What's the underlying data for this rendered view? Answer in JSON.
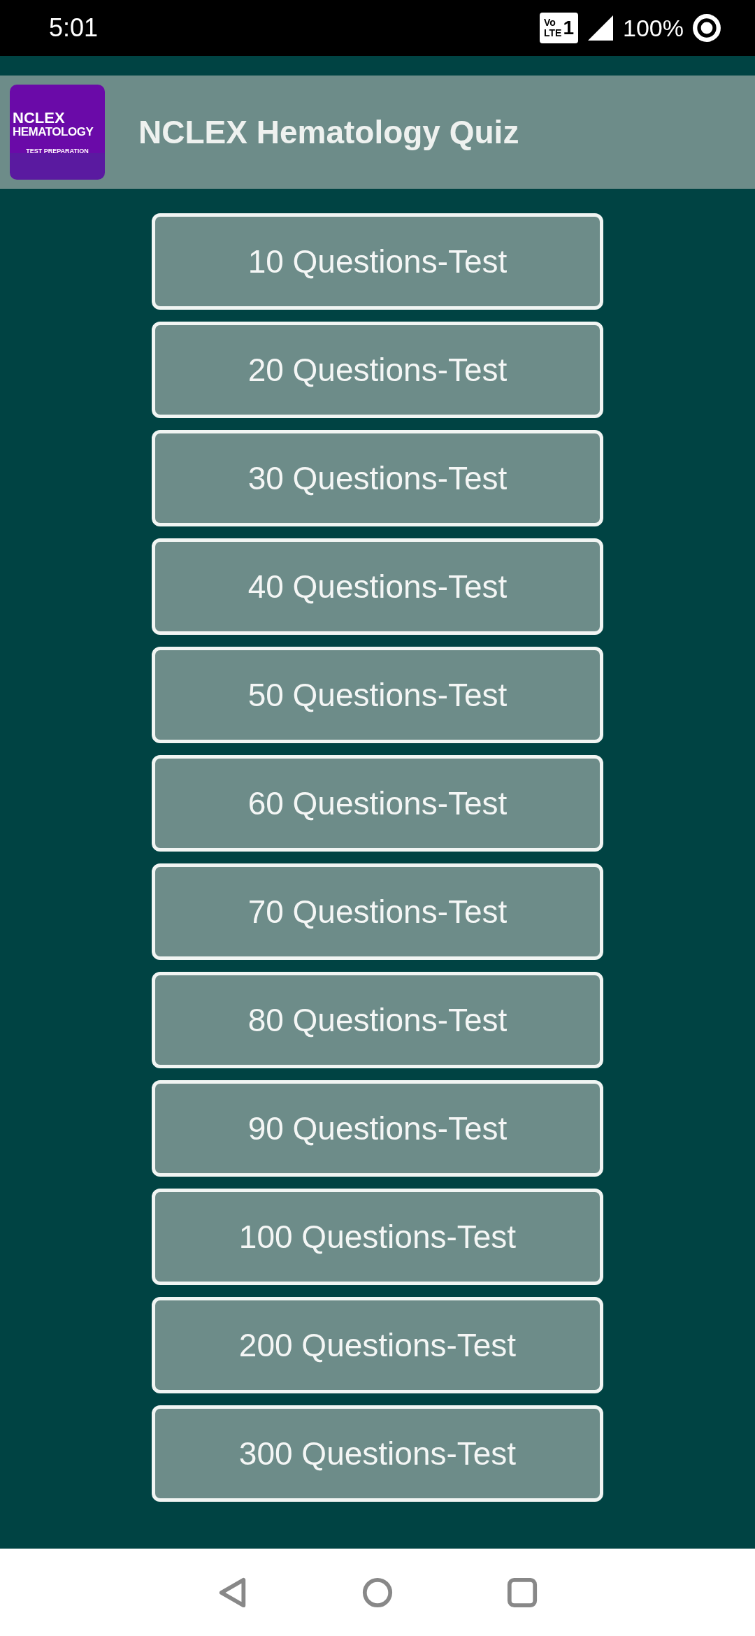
{
  "status_bar": {
    "time": "5:01",
    "network_badge": [
      "Vo",
      "LTE",
      "1"
    ],
    "battery": "100%"
  },
  "app_bar": {
    "logo": {
      "line_1": "NCLEX",
      "line_2": "HEMATOLOGY",
      "line_3": "TEST PREPARATION"
    },
    "title": "NCLEX Hematology Quiz"
  },
  "tests": [
    "10 Questions-Test",
    "20 Questions-Test",
    "30 Questions-Test",
    "40 Questions-Test",
    "50 Questions-Test",
    "60 Questions-Test",
    "70 Questions-Test",
    "80 Questions-Test",
    "90 Questions-Test",
    "100 Questions-Test",
    "200 Questions-Test",
    "300 Questions-Test"
  ]
}
